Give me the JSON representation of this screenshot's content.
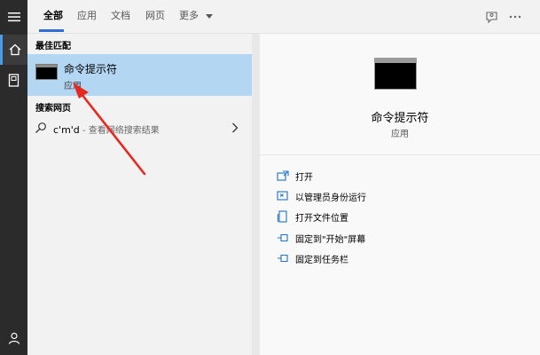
{
  "tabs": [
    {
      "label": "全部"
    },
    {
      "label": "应用"
    },
    {
      "label": "文档"
    },
    {
      "label": "网页"
    },
    {
      "label": "更多"
    }
  ],
  "results": {
    "best_match_label": "最佳匹配",
    "best_match": {
      "title": "命令提示符",
      "subtitle": "应用"
    },
    "web_label": "搜索网页",
    "web_query": "c'm'd",
    "web_hint": " - 查看网络搜索结果"
  },
  "detail": {
    "title": "命令提示符",
    "subtitle": "应用",
    "actions": [
      {
        "label": "打开",
        "icon": "open-icon"
      },
      {
        "label": "以管理员身份运行",
        "icon": "shield-icon"
      },
      {
        "label": "打开文件位置",
        "icon": "file-location-icon"
      },
      {
        "label": "固定到\"开始\"屏幕",
        "icon": "pin-icon"
      },
      {
        "label": "固定到任务栏",
        "icon": "pin-icon"
      }
    ]
  },
  "colors": {
    "accent": "#2f6fd4",
    "selection": "#b3d7f3",
    "rail": "#2b2b2b",
    "icon_blue": "#1e73c8",
    "annotation_arrow": "#e8281e"
  }
}
